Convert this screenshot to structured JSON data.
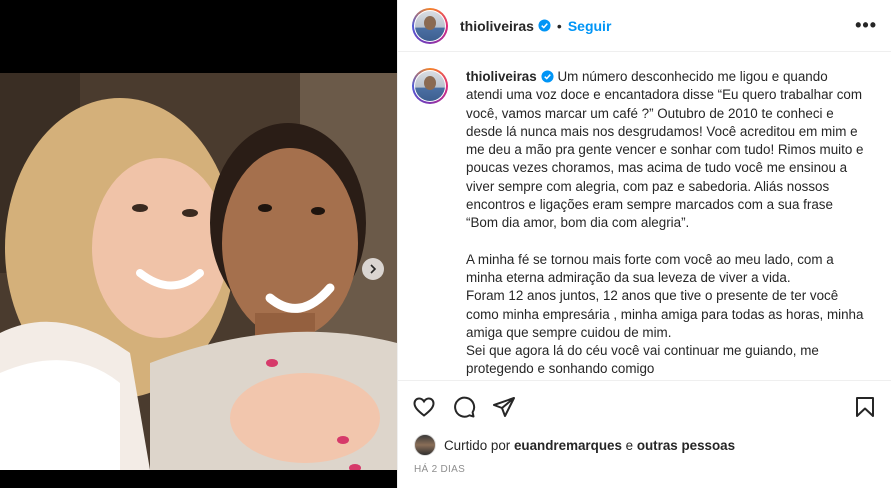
{
  "post": {
    "username": "thioliveiras",
    "follow_label": "Seguir",
    "more_label": "•••",
    "separator": "•",
    "caption_paragraphs": [
      "Um número desconhecido me ligou e quando atendi uma voz doce e encantadora disse “Eu quero trabalhar com você, vamos marcar um café ?” Outubro de 2010 te conheci e desde lá nunca mais nos desgrudamos! Você acreditou em mim e me deu a mão pra gente vencer e sonhar com tudo! Rimos muito e poucas vezes choramos, mas acima de tudo você me ensinou a viver sempre com alegria, com paz e sabedoria. Aliás nossos encontros e ligações eram sempre marcados com a sua frase “Bom dia amor, bom dia com alegria”.",
      "A minha fé se tornou mais forte com você ao meu lado, com a minha eterna admiração da sua leveza de viver a vida.\nForam 12 anos juntos, 12 anos que tive o presente de ter você como minha empresária , minha amiga para todas as horas, minha amiga que sempre cuidou de mim.\nSei que agora lá do céu você vai continuar me guiando, me protegendo e sonhando comigo"
    ],
    "likes": {
      "prefix": "Curtido por",
      "liker": "euandremarques",
      "conjunction": "e",
      "others": "outras pessoas"
    },
    "date": "HÁ 2 DIAS"
  },
  "icons": {
    "verified": "verified-badge-icon",
    "like": "heart-icon",
    "comment": "comment-bubble-icon",
    "share": "paper-plane-icon",
    "save": "bookmark-icon",
    "next": "chevron-right-icon"
  },
  "colors": {
    "accent": "#0095f6",
    "text": "#262626",
    "muted": "#8e8e8e",
    "border": "#efefef"
  }
}
